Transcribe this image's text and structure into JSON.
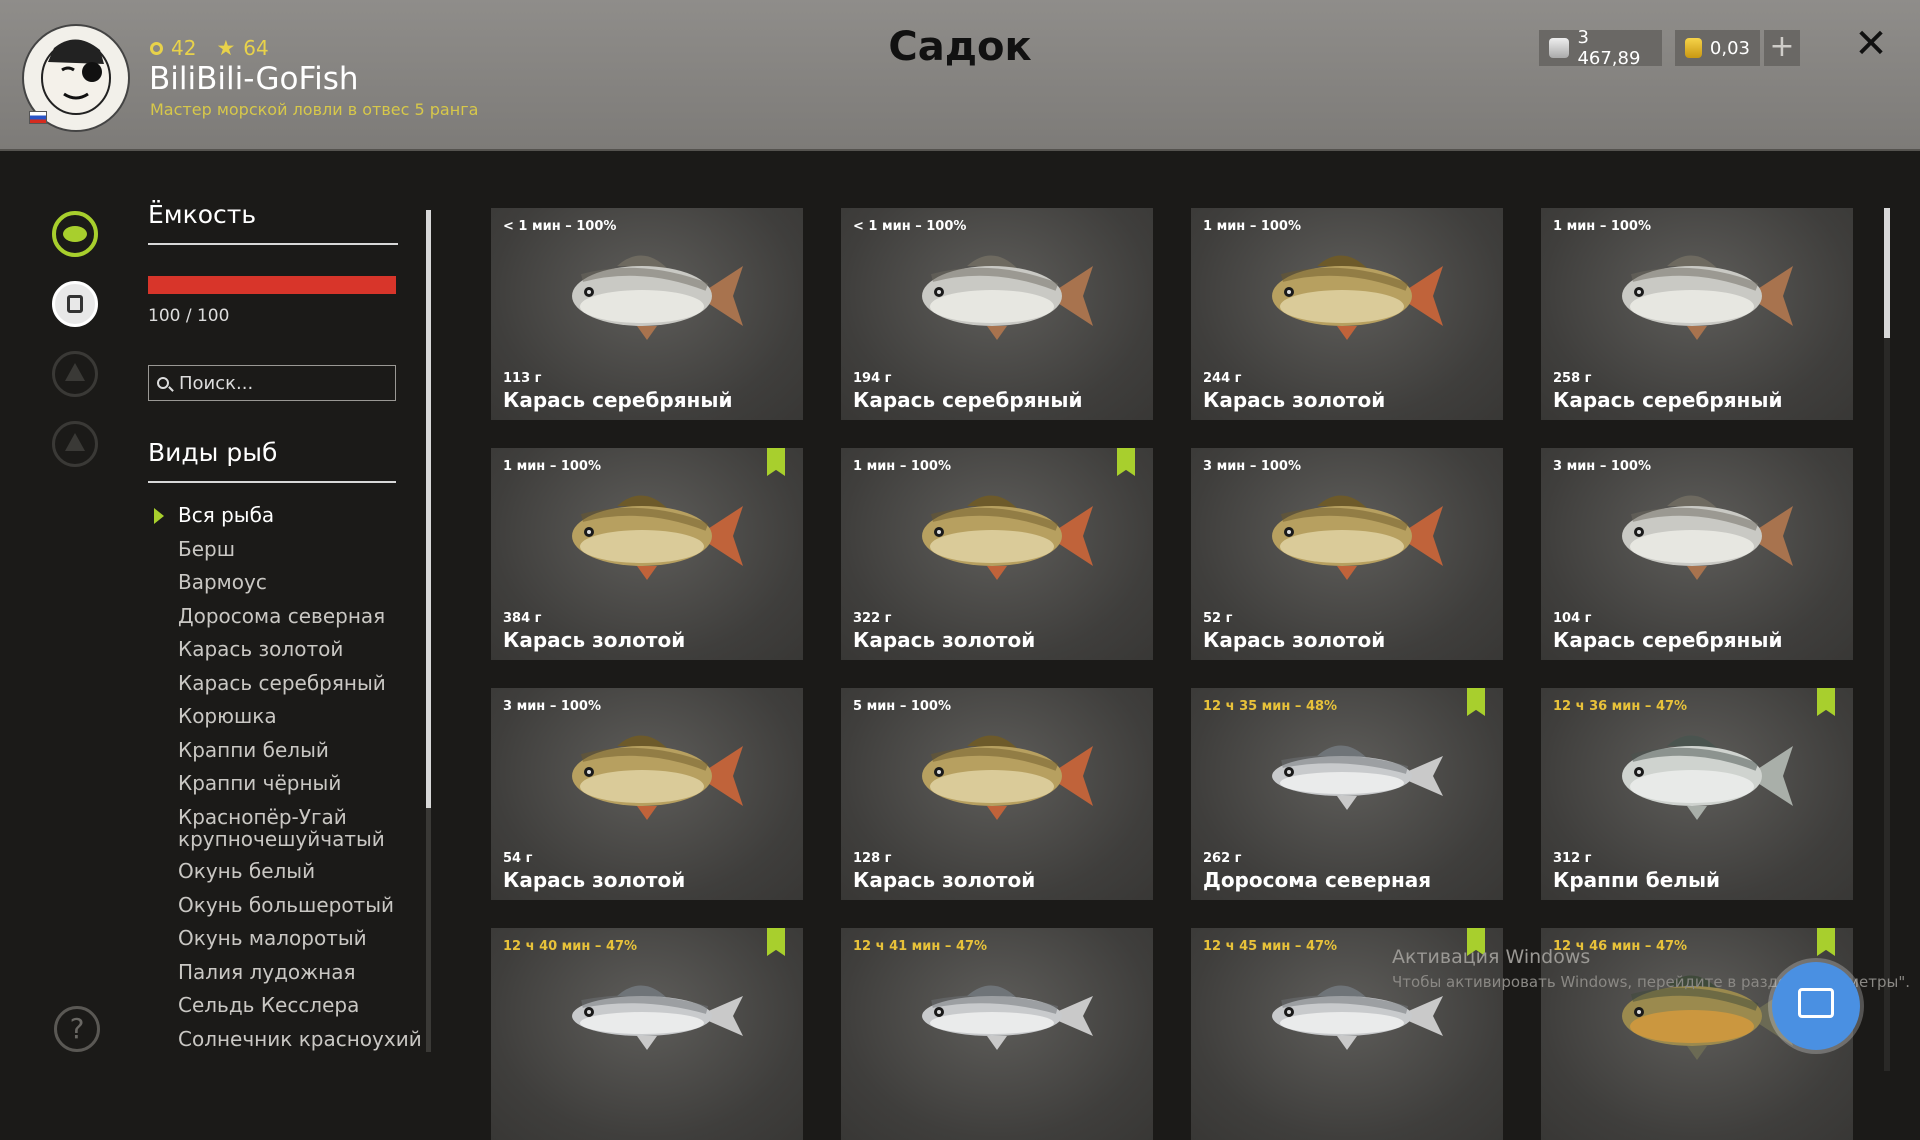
{
  "header": {
    "title": "Садок",
    "level": "42",
    "stars": "64",
    "username": "BiliBili-GoFish",
    "rank": "Мастер морской ловли в отвес 5 ранга",
    "silver": "3 467,89",
    "gold": "0,03",
    "plus": "+",
    "close": "✕"
  },
  "sidebar": {
    "capacity_title": "Ёмкость",
    "capacity_value": "100 / 100",
    "capacity_fraction": 1.0,
    "search_placeholder": "Поиск...",
    "species_title": "Виды рыб",
    "species": [
      "Вся рыба",
      "Берш",
      "Вармоус",
      "Доросома северная",
      "Карась золотой",
      "Карась серебряный",
      "Корюшка",
      "Краппи белый",
      "Краппи чёрный",
      "Краснопёр-Угай крупночешуйчатый",
      "Окунь белый",
      "Окунь большеротый",
      "Окунь малоротый",
      "Палия лудожная",
      "Сельдь Кесслера",
      "Солнечник красноухий"
    ],
    "help": "?"
  },
  "fish_cards": [
    {
      "time": "< 1 мин – 100%",
      "weight": "113 г",
      "name": "Карась серебряный",
      "kind": "silver",
      "marked": false,
      "old": false
    },
    {
      "time": "< 1 мин – 100%",
      "weight": "194 г",
      "name": "Карась серебряный",
      "kind": "silver",
      "marked": false,
      "old": false
    },
    {
      "time": "1 мин – 100%",
      "weight": "244 г",
      "name": "Карась золотой",
      "kind": "gold",
      "marked": false,
      "old": false
    },
    {
      "time": "1 мин – 100%",
      "weight": "258 г",
      "name": "Карась серебряный",
      "kind": "silver",
      "marked": false,
      "old": false
    },
    {
      "time": "1 мин – 100%",
      "weight": "384 г",
      "name": "Карась золотой",
      "kind": "gold",
      "marked": true,
      "old": false
    },
    {
      "time": "1 мин – 100%",
      "weight": "322 г",
      "name": "Карась золотой",
      "kind": "gold",
      "marked": true,
      "old": false
    },
    {
      "time": "3 мин – 100%",
      "weight": "52 г",
      "name": "Карась золотой",
      "kind": "gold",
      "marked": false,
      "old": false
    },
    {
      "time": "3 мин – 100%",
      "weight": "104 г",
      "name": "Карась серебряный",
      "kind": "silver",
      "marked": false,
      "old": false
    },
    {
      "time": "3 мин – 100%",
      "weight": "54 г",
      "name": "Карась золотой",
      "kind": "gold",
      "marked": false,
      "old": false
    },
    {
      "time": "5 мин – 100%",
      "weight": "128 г",
      "name": "Карась золотой",
      "kind": "gold",
      "marked": false,
      "old": false
    },
    {
      "time": "12 ч 35 мин – 48%",
      "weight": "262 г",
      "name": "Доросома северная",
      "kind": "shad",
      "marked": true,
      "old": true
    },
    {
      "time": "12 ч 36 мин – 47%",
      "weight": "312 г",
      "name": "Краппи белый",
      "kind": "crappie",
      "marked": true,
      "old": true
    },
    {
      "time": "12 ч 40 мин – 47%",
      "weight": "",
      "name": "",
      "kind": "shad",
      "marked": true,
      "old": true
    },
    {
      "time": "12 ч 41 мин – 47%",
      "weight": "",
      "name": "",
      "kind": "shad",
      "marked": false,
      "old": true
    },
    {
      "time": "12 ч 45 мин – 47%",
      "weight": "",
      "name": "",
      "kind": "shad",
      "marked": true,
      "old": true
    },
    {
      "time": "12 ч 46 мин – 47%",
      "weight": "",
      "name": "",
      "kind": "sunfish",
      "marked": true,
      "old": true
    }
  ],
  "watermark": {
    "line1": "Активация Windows",
    "line2": "Чтобы активировать Windows, перейдите в раздел \"Параметры\"."
  },
  "colors": {
    "accent": "#a8cf2d",
    "capacity_bar": "#d8352a",
    "old_time": "#e8c23a",
    "fab": "#4a90e2"
  }
}
